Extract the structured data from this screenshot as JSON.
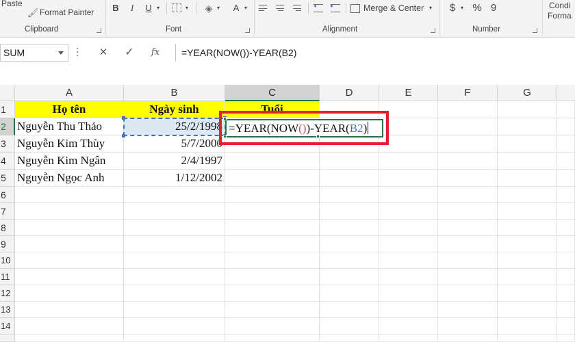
{
  "ribbon": {
    "clipboard": {
      "paste_label": "Paste",
      "format_painter_label": "Format Painter",
      "group_label": "Clipboard"
    },
    "font": {
      "bold": "B",
      "italic": "I",
      "underline": "U",
      "font_color": "A",
      "group_label": "Font"
    },
    "alignment": {
      "merge_center_label": "Merge & Center",
      "group_label": "Alignment"
    },
    "number": {
      "currency": "$",
      "percent": "%",
      "comma": "9",
      "group_label": "Number"
    },
    "styles": {
      "conditional_label_1": "Condi",
      "conditional_label_2": "Forma"
    }
  },
  "formula_bar": {
    "name_box": "SUM",
    "cancel_icon": "×",
    "enter_icon": "✓",
    "fx_label": "fx",
    "formula": "=YEAR(NOW())-YEAR(B2)"
  },
  "sheet": {
    "columns": [
      "A",
      "B",
      "C",
      "D",
      "E",
      "F",
      "G"
    ],
    "rows": [
      "1",
      "2",
      "3",
      "4",
      "5",
      "6",
      "7",
      "8",
      "9",
      "10",
      "11",
      "12",
      "13",
      "14"
    ],
    "headers": {
      "A1": "Họ tên",
      "B1": "Ngày sinh",
      "C1": "Tuổi"
    },
    "data": [
      {
        "name": "Nguyễn Thu Thảo",
        "dob": "25/2/1998"
      },
      {
        "name": "Nguyễn Kim Thùy",
        "dob": "5/7/2000"
      },
      {
        "name": "Nguyễn Kim Ngân",
        "dob": "2/4/1997"
      },
      {
        "name": "Nguyễn Ngọc Anh",
        "dob": "1/12/2002"
      }
    ],
    "editing_cell": {
      "ref": "C2",
      "part_start": "=YEAR(NOW",
      "part_parens": "()",
      "part_mid": ")-YEAR(",
      "part_ref": "B2",
      "part_end": ")"
    },
    "colors": {
      "header_fill": "#ffff00",
      "selection_green": "#217346",
      "ref_blue": "#4472c4",
      "highlight_red": "#e0222e"
    }
  }
}
